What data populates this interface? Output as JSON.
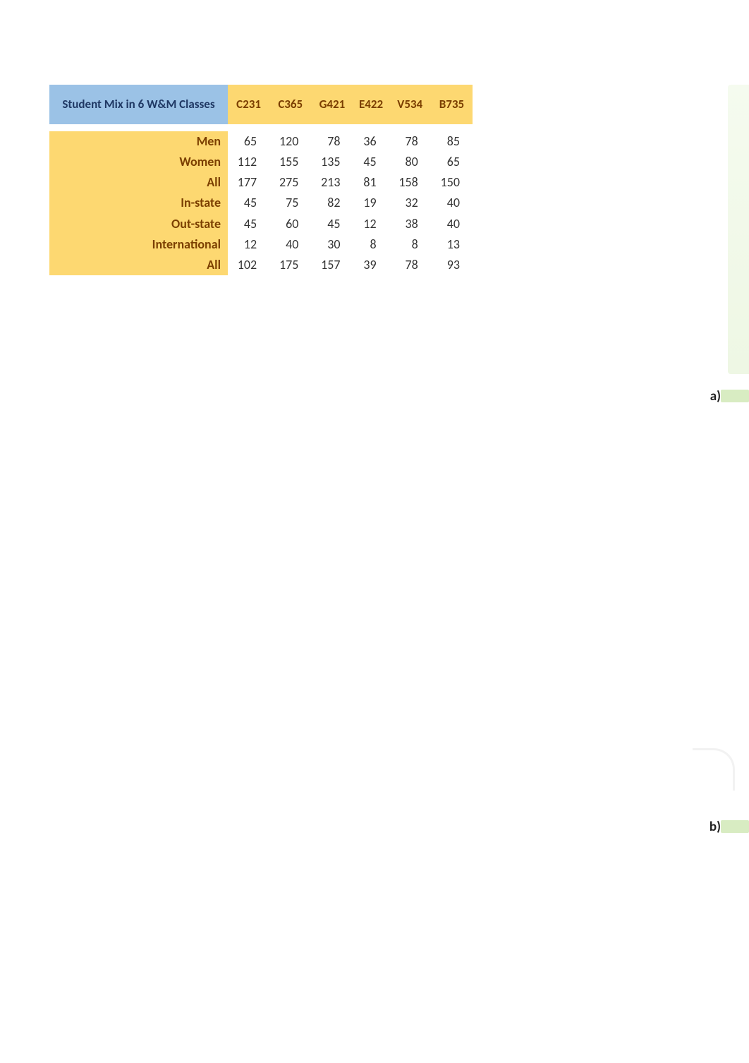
{
  "chart_data": {
    "type": "table",
    "title": "Student Mix in 6 W&M Classes",
    "columns": [
      "C231",
      "C365",
      "G421",
      "E422",
      "V534",
      "B735"
    ],
    "rows": [
      {
        "label": "Men",
        "values": [
          65,
          120,
          78,
          36,
          78,
          85
        ]
      },
      {
        "label": "Women",
        "values": [
          112,
          155,
          135,
          45,
          80,
          65
        ]
      },
      {
        "label": "All",
        "values": [
          177,
          275,
          213,
          81,
          158,
          150
        ]
      },
      {
        "label": "In-state",
        "values": [
          45,
          75,
          82,
          19,
          32,
          40
        ]
      },
      {
        "label": "Out-state",
        "values": [
          45,
          60,
          45,
          12,
          38,
          40
        ]
      },
      {
        "label": "International",
        "values": [
          12,
          40,
          30,
          8,
          8,
          13
        ]
      },
      {
        "label": "All",
        "values": [
          102,
          175,
          157,
          39,
          78,
          93
        ]
      }
    ]
  },
  "labels": {
    "a": "a)",
    "b": "b)"
  }
}
